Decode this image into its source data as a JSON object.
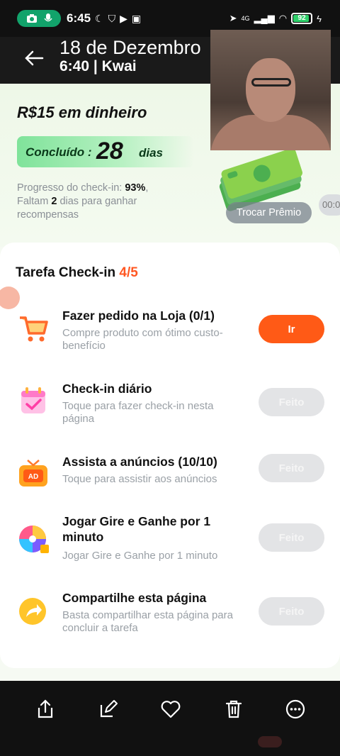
{
  "status_bar": {
    "time": "6:45",
    "network": "4G",
    "battery": "92",
    "battery_level": 0.92
  },
  "overlay": {
    "date": "18 de Dezembro",
    "subtitle": "6:40 | Kwai"
  },
  "hero": {
    "cash_title": "R$15 em dinheiro",
    "done_label": "Concluído :",
    "done_days": "28",
    "done_unit": "dias",
    "progress_prefix": "Progresso do check-in: ",
    "progress_value": "93%",
    "progress_suffix": ",",
    "remaining_prefix": "Faltam ",
    "remaining_value": "2",
    "remaining_suffix": " dias para ganhar recompensas",
    "exchange_button": "Trocar Prêmio",
    "timer": "00:0"
  },
  "tasks_section": {
    "title": "Tarefa Check-in ",
    "count": "4/5"
  },
  "tasks": [
    {
      "name": "Fazer pedido na Loja  (0/1)",
      "desc": "Compre produto com ótimo custo-benefício",
      "button": "Ir",
      "icon": "shopping-cart-icon",
      "done": false
    },
    {
      "name": "Check-in diário",
      "desc": "Toque para fazer check-in nesta página",
      "button": "Feito",
      "icon": "calendar-check-icon",
      "done": true
    },
    {
      "name": "Assista a anúncios  (10/10)",
      "desc": "Toque para assistir aos anúncios",
      "button": "Feito",
      "icon": "ad-tv-icon",
      "done": true
    },
    {
      "name": "Jogar Gire e Ganhe por 1 minuto",
      "desc": "Jogar Gire e Ganhe por 1 minuto",
      "button": "Feito",
      "icon": "spin-wheel-icon",
      "done": true
    },
    {
      "name": "Compartilhe esta página",
      "desc": "Basta compartilhar esta página para concluir a tarefa",
      "button": "Feito",
      "icon": "share-arrow-icon",
      "done": true
    }
  ],
  "toolbar": {
    "actions": [
      "share-icon",
      "edit-icon",
      "heart-icon",
      "trash-icon",
      "more-icon"
    ]
  },
  "colors": {
    "accent": "#ff5a16",
    "done_button": "#e3e4e6",
    "green_pill": "#7fe39a",
    "count": "#ff5722"
  }
}
